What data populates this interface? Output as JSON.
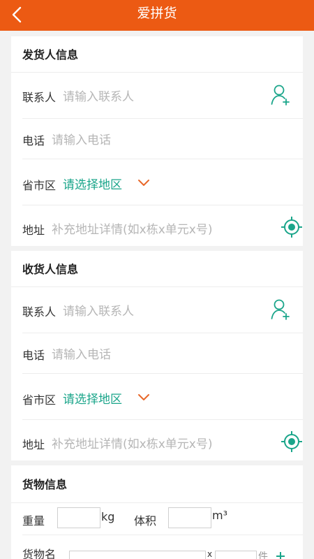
{
  "header": {
    "title": "爱拼货"
  },
  "sender": {
    "title": "发货人信息",
    "contact_label": "联系人",
    "contact_placeholder": "请输入联系人",
    "phone_label": "电话",
    "phone_placeholder": "请输入电话",
    "region_label": "省市区",
    "region_value": "请选择地区",
    "address_label": "地址",
    "address_placeholder": "补充地址详情(如x栋x单元x号)"
  },
  "receiver": {
    "title": "收货人信息",
    "contact_label": "联系人",
    "contact_placeholder": "请输入联系人",
    "phone_label": "电话",
    "phone_placeholder": "请输入电话",
    "region_label": "省市区",
    "region_value": "请选择地区",
    "address_label": "地址",
    "address_placeholder": "补充地址详情(如x栋x单元x号)"
  },
  "cargo": {
    "title": "货物信息",
    "weight_label": "重量",
    "weight_value": "",
    "weight_unit": "kg",
    "volume_label": "体积",
    "volume_value": "",
    "volume_unit": "m³",
    "name_label": "货物名",
    "name_value": "",
    "qty_sep": "x",
    "qty_value": "",
    "qty_unit": "件"
  },
  "colors": {
    "header": "#ec5a13",
    "accent": "#1aa58a",
    "arrow": "#e8682a"
  },
  "icons": {
    "back": "chevron-left-icon",
    "contact": "add-contact-icon",
    "location": "locate-target-icon",
    "dropdown": "chevron-down-icon",
    "add": "plus-icon"
  }
}
